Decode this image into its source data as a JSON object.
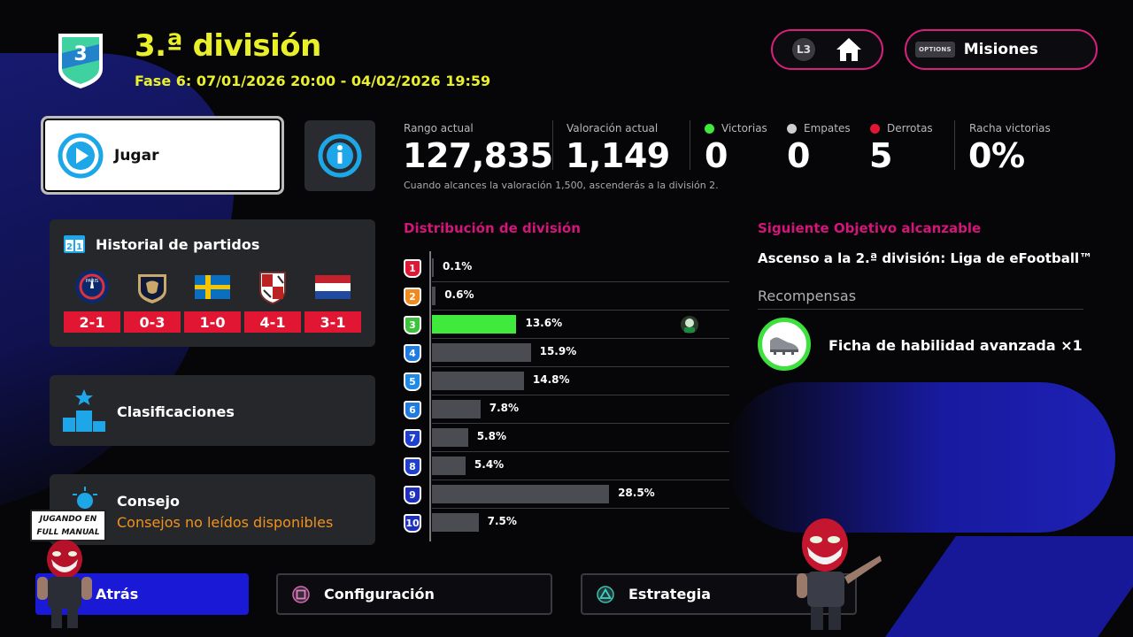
{
  "header": {
    "badge_number": "3",
    "title": "3.ª división",
    "phase": "Fase 6: 07/01/2026 20:00 - 04/02/2026 19:59",
    "home_button_tag": "L3",
    "missions_button_tag": "OPTIONS",
    "missions_label": "Misiones"
  },
  "play": {
    "label": "Jugar"
  },
  "stats": {
    "rank_label": "Rango actual",
    "rank_value": "127,835",
    "rating_label": "Valoración actual",
    "rating_value": "1,149",
    "wins_label": "Victorias",
    "wins_value": "0",
    "draws_label": "Empates",
    "draws_value": "0",
    "losses_label": "Derrotas",
    "losses_value": "5",
    "streak_label": "Racha victorias",
    "streak_value": "0%",
    "note": "Cuando alcances la valoración 1,500, ascenderás a la división 2.",
    "colors": {
      "wins": "#3fea3d",
      "draws": "#cfcfcf",
      "losses": "#e01633"
    }
  },
  "history": {
    "title": "Historial de partidos",
    "matches": [
      {
        "crest": "psg-crest-icon",
        "score": "2-1"
      },
      {
        "crest": "pumas-crest-icon",
        "score": "0-3"
      },
      {
        "crest": "sweden-flag-icon",
        "score": "1-0"
      },
      {
        "crest": "shield-crest-icon",
        "score": "4-1"
      },
      {
        "crest": "netherlands-flag-icon",
        "score": "3-1"
      }
    ]
  },
  "classifications": {
    "label": "Clasificaciones"
  },
  "tip": {
    "title": "Consejo",
    "subtitle": "Consejos no leídos disponibles"
  },
  "distribution": {
    "title": "Distribución de división",
    "current_division": 3,
    "rows": [
      {
        "division": "1",
        "percent": 0.1,
        "label": "0.1%",
        "color": "#e01633"
      },
      {
        "division": "2",
        "percent": 0.6,
        "label": "0.6%",
        "color": "#f08a1e"
      },
      {
        "division": "3",
        "percent": 13.6,
        "label": "13.6%",
        "color": "#3ec13e"
      },
      {
        "division": "4",
        "percent": 15.9,
        "label": "15.9%",
        "color": "#1e7be0"
      },
      {
        "division": "5",
        "percent": 14.8,
        "label": "14.8%",
        "color": "#1e8ae8"
      },
      {
        "division": "6",
        "percent": 7.8,
        "label": "7.8%",
        "color": "#1e7be0"
      },
      {
        "division": "7",
        "percent": 5.8,
        "label": "5.8%",
        "color": "#1e3fd0"
      },
      {
        "division": "8",
        "percent": 5.4,
        "label": "5.4%",
        "color": "#1e3fd0"
      },
      {
        "division": "9",
        "percent": 28.5,
        "label": "28.5%",
        "color": "#1e2fc0"
      },
      {
        "division": "10",
        "percent": 7.5,
        "label": "7.5%",
        "color": "#1e2fc0"
      }
    ]
  },
  "objective": {
    "title": "Siguiente Objetivo alcanzable",
    "text": "Ascenso a la 2.ª división: Liga de eFootball™",
    "rewards_label": "Recompensas",
    "reward_text": "Ficha de habilidad avanzada ×1"
  },
  "footer": {
    "back_label": "Atrás",
    "config_label": "Configuración",
    "strategy_label": "Estrategia"
  },
  "overlay": {
    "sticker_line1": "JUGANDO EN",
    "sticker_line2": "FULL MANUAL"
  }
}
